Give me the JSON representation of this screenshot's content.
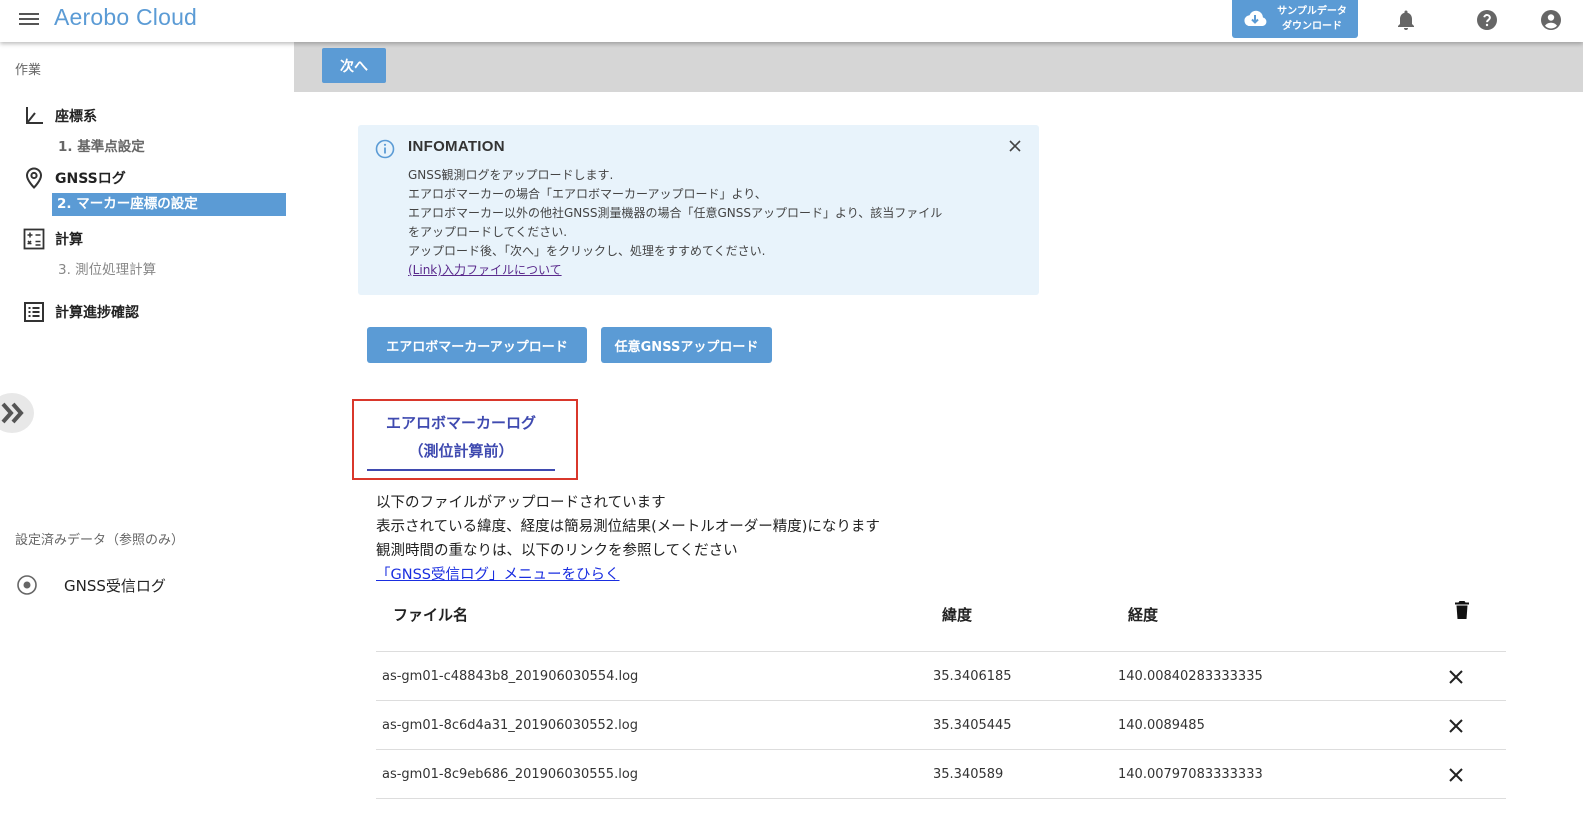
{
  "header": {
    "title": "Aerobo Cloud",
    "sample_button_line1": "サンプルデータ",
    "sample_button_line2": "ダウンロード",
    "icons": [
      "menu-icon",
      "cloud-download-icon",
      "bell-icon",
      "help-icon",
      "account-icon"
    ]
  },
  "sidebar": {
    "work_label": "作業",
    "items": [
      {
        "label": "座標系",
        "icon": "axis-icon"
      },
      {
        "label": "GNSSログ",
        "icon": "location-pin-icon"
      },
      {
        "label": "計算",
        "icon": "calculator-icon"
      },
      {
        "label": "計算進捗確認",
        "icon": "list-icon"
      }
    ],
    "sub_items": {
      "step1": "1. 基準点設定",
      "step2": "2. マーカー座標の設定",
      "step3": "3. 測位処理計算"
    },
    "configured_label": "設定済みデータ（参照のみ）",
    "gnss_receive_log": "GNSS受信ログ"
  },
  "toolbar": {
    "next_label": "次へ"
  },
  "info": {
    "title": "INFOMATION",
    "lines": [
      "GNSS観測ログをアップロードします.",
      "エアロボマーカーの場合「エアロボマーカーアップロード」より、",
      "エアロボマーカー以外の他社GNSS測量機器の場合「任意GNSSアップロード」より、該当ファイル",
      "をアップロードしてください.",
      "アップロード後、「次へ」をクリックし、処理をすすめてください."
    ],
    "link": "(Link)入力ファイルについて"
  },
  "buttons": {
    "aerobo_upload": "エアロボマーカーアップロード",
    "gnss_upload": "任意GNSSアップロード"
  },
  "tab": {
    "line1": "エアロボマーカーログ",
    "line2": "（測位計算前）"
  },
  "description": {
    "line1": "以下のファイルがアップロードされています",
    "line2": "表示されている緯度、経度は簡易測位結果(メートルオーダー精度)になります",
    "line3": "観測時間の重なりは、以下のリンクを参照してください",
    "link": "「GNSS受信ログ」メニューをひらく"
  },
  "table": {
    "headers": {
      "filename": "ファイル名",
      "lat": "緯度",
      "lon": "経度"
    },
    "rows": [
      {
        "filename": "as-gm01-c48843b8_201906030554.log",
        "lat": "35.3406185",
        "lon": "140.00840283333335"
      },
      {
        "filename": "as-gm01-8c6d4a31_201906030552.log",
        "lat": "35.3405445",
        "lon": "140.0089485"
      },
      {
        "filename": "as-gm01-8c9eb686_201906030555.log",
        "lat": "35.340589",
        "lon": "140.00797083333333"
      }
    ]
  },
  "colors": {
    "accent": "#5b9bd5",
    "tab": "#3f4ab0",
    "highlight_border": "#d9372b",
    "info_bg": "#e8f3fb"
  }
}
